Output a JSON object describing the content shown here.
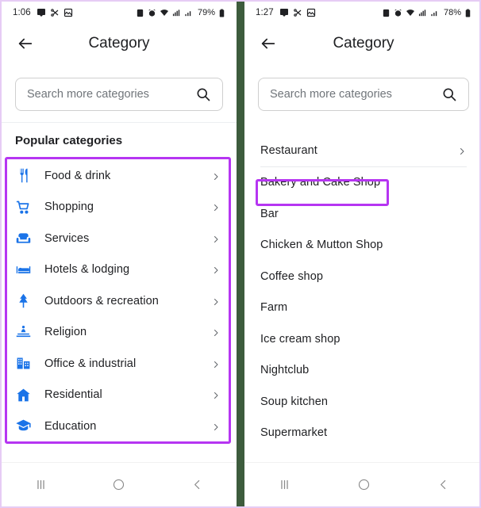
{
  "left": {
    "status_bar": {
      "time": "1:06",
      "battery_text": "79%",
      "left_icons": [
        "chat-bubble-icon",
        "scissors-icon",
        "gallery-icon"
      ],
      "right_icons": [
        "dnd-icon",
        "alarm-icon",
        "wifi-icon",
        "mobile-data-icon",
        "signal-bars-icon",
        "battery-icon"
      ]
    },
    "title": "Category",
    "back_icon": "back-arrow-icon",
    "search": {
      "placeholder": "Search more categories",
      "value": "",
      "icon": "search-icon"
    },
    "section_title": "Popular categories",
    "items": [
      {
        "label": "Food & drink",
        "icon": "fork-knife-icon"
      },
      {
        "label": "Shopping",
        "icon": "shopping-cart-icon"
      },
      {
        "label": "Services",
        "icon": "armchair-icon"
      },
      {
        "label": "Hotels & lodging",
        "icon": "bed-icon"
      },
      {
        "label": "Outdoors & recreation",
        "icon": "tree-icon"
      },
      {
        "label": "Religion",
        "icon": "temple-icon"
      },
      {
        "label": "Office & industrial",
        "icon": "office-building-icon"
      },
      {
        "label": "Residential",
        "icon": "house-icon"
      },
      {
        "label": "Education",
        "icon": "graduation-cap-icon"
      }
    ]
  },
  "right": {
    "status_bar": {
      "time": "1:27",
      "battery_text": "78%",
      "left_icons": [
        "chat-bubble-icon",
        "scissors-icon",
        "gallery-icon"
      ],
      "right_icons": [
        "dnd-icon",
        "alarm-icon",
        "wifi-icon",
        "mobile-data-icon",
        "signal-bars-icon",
        "battery-icon"
      ]
    },
    "title": "Category",
    "back_icon": "back-arrow-icon",
    "search": {
      "placeholder": "Search more categories",
      "value": "",
      "icon": "search-icon"
    },
    "items": [
      {
        "label": "Restaurant",
        "chevron": true
      },
      {
        "label": "Bakery and Cake Shop",
        "chevron": false
      },
      {
        "label": "Bar",
        "chevron": false
      },
      {
        "label": "Chicken & Mutton Shop",
        "chevron": false
      },
      {
        "label": "Coffee shop",
        "chevron": false
      },
      {
        "label": "Farm",
        "chevron": false
      },
      {
        "label": "Ice cream shop",
        "chevron": false
      },
      {
        "label": "Nightclub",
        "chevron": false
      },
      {
        "label": "Soup kitchen",
        "chevron": false
      },
      {
        "label": "Supermarket",
        "chevron": false
      }
    ]
  },
  "navbar": {
    "recents_icon": "recents-bars-icon",
    "home_icon": "home-circle-icon",
    "back_icon": "back-chevron-icon"
  },
  "colors": {
    "highlight": "#b635f2",
    "icon_blue": "#1a73e8",
    "divider_green": "#3d5c3d",
    "frame_border": "#e6ccf5"
  }
}
